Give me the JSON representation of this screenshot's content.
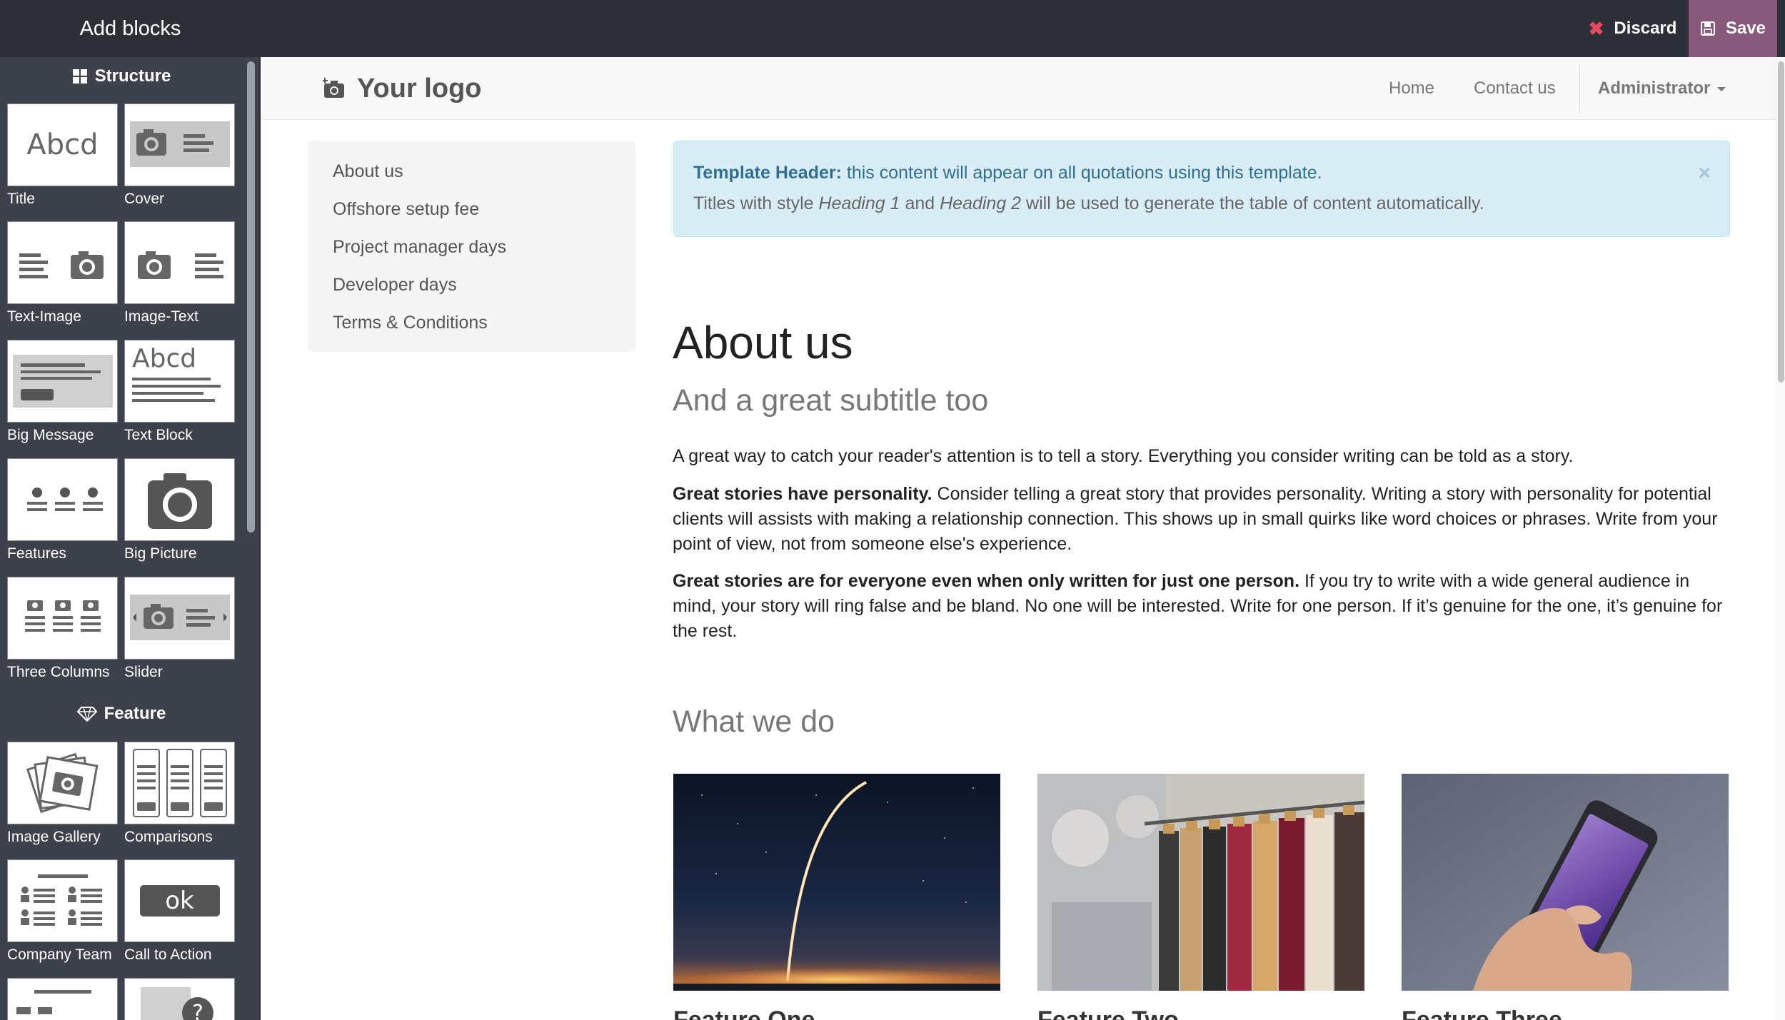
{
  "editor": {
    "add_blocks_label": "Add blocks",
    "discard_label": "Discard",
    "save_label": "Save",
    "accent_color": "#875a7b"
  },
  "sidebar": {
    "sections": [
      {
        "title": "Structure",
        "icon": "grid-icon",
        "blocks": [
          {
            "label": "Title",
            "icon": "title-thumb"
          },
          {
            "label": "Cover",
            "icon": "cover-thumb"
          },
          {
            "label": "Text-Image",
            "icon": "text-image-thumb"
          },
          {
            "label": "Image-Text",
            "icon": "image-text-thumb"
          },
          {
            "label": "Big Message",
            "icon": "big-message-thumb"
          },
          {
            "label": "Text Block",
            "icon": "text-block-thumb"
          },
          {
            "label": "Features",
            "icon": "features-thumb"
          },
          {
            "label": "Big Picture",
            "icon": "big-picture-thumb"
          },
          {
            "label": "Three Columns",
            "icon": "three-columns-thumb"
          },
          {
            "label": "Slider",
            "icon": "slider-thumb"
          }
        ]
      },
      {
        "title": "Feature",
        "icon": "diamond-icon",
        "blocks": [
          {
            "label": "Image Gallery",
            "icon": "image-gallery-thumb"
          },
          {
            "label": "Comparisons",
            "icon": "comparisons-thumb"
          },
          {
            "label": "Company Team",
            "icon": "company-team-thumb"
          },
          {
            "label": "Call to Action",
            "icon": "call-to-action-thumb",
            "thumb_text": "ok"
          }
        ]
      }
    ],
    "title_thumb_text": "Abcd",
    "text_block_thumb_text": "Abcd"
  },
  "navbar": {
    "logo_text": "Your logo",
    "links": [
      "Home",
      "Contact us"
    ],
    "user_menu": "Administrator"
  },
  "toc": {
    "items": [
      "About us",
      "Offshore setup fee",
      "Project manager days",
      "Developer days",
      "Terms & Conditions"
    ]
  },
  "alert": {
    "title": "Template Header:",
    "message": " this content will appear on all quotations using this template.",
    "line2_a": "Titles with style ",
    "line2_em1": "Heading 1",
    "line2_b": " and ",
    "line2_em2": "Heading 2",
    "line2_c": " will be used to generate the table of content automatically.",
    "close": "×"
  },
  "content": {
    "heading": "About us",
    "subtitle": "And a great subtitle too",
    "p1": "A great way to catch your reader's attention is to tell a story. Everything you consider writing can be told as a story.",
    "p2_bold": "Great stories have personality.",
    "p2": " Consider telling a great story that provides personality. Writing a story with personality for potential clients will assists with making a relationship connection. This shows up in small quirks like word choices or phrases. Write from your point of view, not from someone else's experience.",
    "p3_bold": "Great stories are for everyone even when only written for just one person.",
    "p3": " If you try to write with a wide general audience in mind, your story will ring false and be bland. No one will be interested. Write for one person. If it’s genuine for the one, it’s genuine for the rest.",
    "what_heading": "What we do",
    "features": [
      {
        "title": "Feature One",
        "image": "rocket-launch-photo"
      },
      {
        "title": "Feature Two",
        "image": "clothing-rack-photo"
      },
      {
        "title": "Feature Three",
        "image": "smartphone-hand-photo"
      }
    ]
  }
}
